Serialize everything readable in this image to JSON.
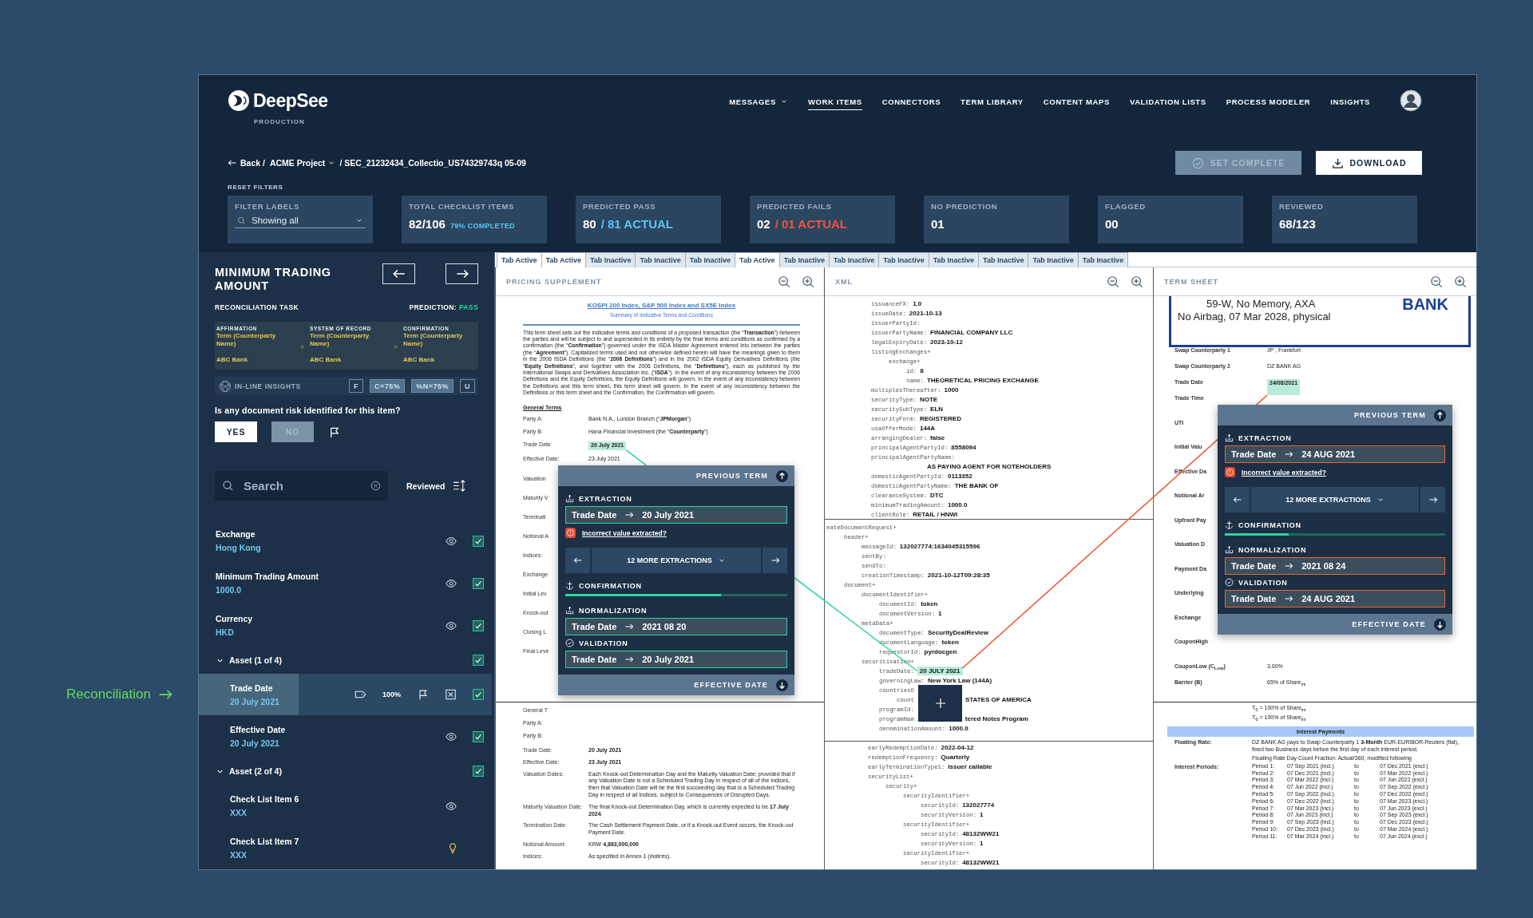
{
  "app": {
    "logo": "DeepSee",
    "environment": "PRODUCTION"
  },
  "nav": [
    {
      "label": "MESSAGES",
      "dropdown": true,
      "selected": false
    },
    {
      "label": "WORK ITEMS",
      "dropdown": false,
      "selected": true
    },
    {
      "label": "CONNECTORS",
      "dropdown": false,
      "selected": false
    },
    {
      "label": "TERM LIBRARY",
      "dropdown": false,
      "selected": false
    },
    {
      "label": "CONTENT MAPS",
      "dropdown": false,
      "selected": false
    },
    {
      "label": "VALIDATION LISTS",
      "dropdown": false,
      "selected": false
    },
    {
      "label": "PROCESS MODELER",
      "dropdown": false,
      "selected": false
    },
    {
      "label": "INSIGHTS",
      "dropdown": false,
      "selected": false
    }
  ],
  "breadcrumb": {
    "back": "Back /",
    "project": "ACME Project",
    "path": "/ SEC_21232434_Collectio_US74329743q 05-09"
  },
  "actions": [
    {
      "label": "SET COMPLETE",
      "kind": "complete",
      "disabled": true
    },
    {
      "label": "DOWNLOAD",
      "kind": "download",
      "disabled": false
    }
  ],
  "reset_filters": "RESET FILTERS",
  "filter": {
    "label": "FILTER LABELS",
    "value": "Showing all"
  },
  "stats": [
    {
      "label": "TOTAL CHECKLIST ITEMS",
      "value": "82/106",
      "extra": "79% COMPLETED",
      "kind": "percent"
    },
    {
      "label": "PREDICTED PASS",
      "value": "80",
      "extra": "/ 81 ACTUAL",
      "kind": "pass"
    },
    {
      "label": "PREDICTED FAILS",
      "value": "02",
      "extra": "/ 01 ACTUAL",
      "kind": "fail"
    },
    {
      "label": "NO PREDICTION",
      "value": "01"
    },
    {
      "label": "FLAGGED",
      "value": "00"
    },
    {
      "label": "REVIEWED",
      "value": "68/123"
    }
  ],
  "side_label": "Reconciliation",
  "task": {
    "title": "MINIMUM TRADING AMOUNT",
    "subtitle": "RECONCILIATION TASK",
    "prediction_label": "PREDICTION:",
    "prediction": "PASS"
  },
  "reconciliation": {
    "columns": [
      {
        "source": "AFFIRMATION",
        "term": "Term (Counterparty Name)",
        "value": "ABC Bank"
      },
      {
        "source": "SYSTEM OF RECORD",
        "term": "Term (Counterparty Name)",
        "value": "ABC Bank"
      },
      {
        "source": "CONFIRMATION",
        "term": "Term (Counterparty Name)",
        "value": "ABC Bank"
      }
    ],
    "separators": [
      "=",
      "="
    ]
  },
  "insights": {
    "label": "IN-LINE INSIGHTS",
    "chips": [
      {
        "label": "F",
        "active": false
      },
      {
        "label": "C=75%",
        "active": true
      },
      {
        "label": "%N=75%",
        "active": true
      },
      {
        "label": "U",
        "active": false
      }
    ]
  },
  "risk": {
    "question": "Is any document risk identified for this item?",
    "options": [
      {
        "label": "YES",
        "selected": true
      },
      {
        "label": "NO",
        "selected": false
      }
    ]
  },
  "search": {
    "placeholder": "Search"
  },
  "sort": {
    "label": "Reviewed"
  },
  "checklist": [
    {
      "kind": "item",
      "label": "Exchange",
      "value": "Hong Kong",
      "reviewed": true,
      "selected": false,
      "hint": false
    },
    {
      "kind": "item",
      "label": "Minimum Trading Amount",
      "value": "1000.0",
      "reviewed": true,
      "selected": false,
      "hint": false
    },
    {
      "kind": "item",
      "label": "Currency",
      "value": "HKD",
      "reviewed": true,
      "selected": false,
      "hint": false
    },
    {
      "kind": "group",
      "label": "Asset (1 of 4)",
      "expanded": true,
      "reviewed": true,
      "children": [
        {
          "kind": "item",
          "label": "Trade Date",
          "value": "20 July 2021",
          "reviewed": true,
          "selected": true,
          "confidence": "100%",
          "hint": false
        },
        {
          "kind": "item",
          "label": "Effective Date",
          "value": "20 July 2021",
          "reviewed": true,
          "selected": false,
          "hint": false
        }
      ]
    },
    {
      "kind": "group",
      "label": "Asset (2 of 4)",
      "expanded": true,
      "reviewed": true,
      "children": [
        {
          "kind": "item",
          "label": "Check List Item 6",
          "value": "XXX",
          "reviewed": false,
          "selected": false,
          "hint": false
        },
        {
          "kind": "item",
          "label": "Check List Item 7",
          "value": "XXX",
          "reviewed": false,
          "selected": false,
          "hint": true
        }
      ]
    }
  ],
  "doc_tabs": [
    {
      "label": "Tab Active",
      "selected": true
    },
    {
      "label": "Tab Active",
      "selected": true
    },
    {
      "label": "Tab Inactive",
      "selected": false
    },
    {
      "label": "Tab Inactive",
      "selected": false
    },
    {
      "label": "Tab Inactive",
      "selected": false
    },
    {
      "label": "Tab Active",
      "selected": true
    },
    {
      "label": "Tab Inactive",
      "selected": false
    },
    {
      "label": "Tab Inactive",
      "selected": false
    },
    {
      "label": "Tab Inactive",
      "selected": false
    },
    {
      "label": "Tab Inactive",
      "selected": false
    },
    {
      "label": "Tab Inactive",
      "selected": false
    },
    {
      "label": "Tab Inactive",
      "selected": false
    },
    {
      "label": "Tab Inactive",
      "selected": false
    }
  ],
  "connectors": [
    {
      "color": "#2ed3a0"
    },
    {
      "color": "#e8572a"
    }
  ],
  "panes": [
    {
      "kind": "pricing",
      "title": "PRICING SUPPLEMENT",
      "heading": "KOSPI 200 Index, S&P 500 Index and SX5E Index",
      "subheading": "Summary of Indicative Terms and Conditions",
      "intro": "This term sheet sets out the indicative terms and conditions of a proposed transaction (the “**Transaction**”) between the parties and will be subject to and superseded in its entirety by the final terms and conditions as confirmed by a confirmation (the “**Confirmation**”) governed under the ISDA Master Agreement entered into between the parties (the “**Agreement**”). Capitalized terms used and not otherwise defined herein will have the meanings given to them in the 2006 ISDA Definitions (the “**2006 Definitions**”) and in the 2002 ISDA Equity Derivatives Definitions (the “**Equity Definitions**”, and together with the 2006 Definitions, the “**Definitions**”), each as published by the International Swaps and Derivatives Association Inc. (“**ISDA**”). In the event of any inconsistency between the 2006 Definitions and the Equity Definitions, the Equity Definitions will govern. In the event of any inconsistency between the Definitions and this term sheet, this term sheet will govern. In the event of any inconsistency between the Definitions or this term sheet and the Confirmation, the Confirmation will govern.",
      "section": "General Terms",
      "rows": [
        {
          "label": "Party A:",
          "value": "Bank N.A., London Branch (“**JPMorgan**”)",
          "highlight": false
        },
        {
          "label": "Party B:",
          "value": "Hana Financial Investment  (the “**Counterparty**”)",
          "highlight": false
        },
        {
          "label": "Trade Date:",
          "value": "20 July 2021",
          "highlight": true
        },
        {
          "label": "Effective Date:",
          "value": "23 July 2021",
          "highlight": false
        }
      ],
      "covered": [
        "Valuation",
        "Maturity V",
        "Terminati",
        "Notional A",
        "Indices:",
        "Exchange",
        "Initial Lev",
        "Knock-out",
        "Closing L",
        "Final Leve"
      ],
      "page2_covered": [
        "General T",
        "Party A:",
        "Party B:"
      ],
      "page2_rows": [
        {
          "label": "Trade Date:",
          "value": "**20 July 2021**"
        },
        {
          "label": "Effective Date:",
          "value": "**23 July 2021**"
        },
        {
          "label": "Valuation Dates:",
          "value": "Each Knock-out Determination Day and the Maturity Valuation Date; provided that if any Valuation Date is not a Scheduled Trading Day in respect of all of the Indices, then that Valuation Date will be the first succeeding day that is a Scheduled Trading Day in respect of all Indices, subject to Consequences of Disrupted Days."
        },
        {
          "label": "Maturity Valuation Date:",
          "value": "The final Knock-out Determination Day, which is currently expected to be **17 July 2024**."
        },
        {
          "label": "Termination Date:",
          "value": "The Cash Settlement Payment Date, or if a Knock-out Event occurs, the Knock-out Payment Date."
        },
        {
          "label": "Notional Amount:",
          "value": "KRW  **4,863,000,000**"
        },
        {
          "label": "Indices:",
          "value": "As specified in Annex 1 (*Indices*)."
        }
      ],
      "popup": {
        "kind": "match",
        "previous": "PREVIOUS TERM",
        "next": "EFFECTIVE DATE",
        "extraction": {
          "label": "EXTRACTION",
          "term": "Trade Date",
          "value": "20 July 2021"
        },
        "error": "Incorrect value extracted?",
        "more": "12 MORE EXTRACTIONS",
        "confirmation": {
          "label": "CONFIRMATION",
          "level": 0.7
        },
        "normalization": {
          "label": "NORMALIZATION",
          "term": "Trade Date",
          "value": "2021 08 20"
        },
        "validation": {
          "label": "VALIDATION",
          "term": "Trade Date",
          "value": "20 July 2021"
        }
      }
    },
    {
      "kind": "xml",
      "title": "XML",
      "sections": [
        [
          {
            "key": "issuanceFX:",
            "value": "1.0"
          },
          {
            "key": "issueDate:",
            "value": "2021-10-13"
          },
          {
            "key": "issuerPartyId:"
          },
          {
            "key": "issuerPartyName:",
            "value": "FINANCIAL COMPANY LLC"
          },
          {
            "key": "legalExpiryDate:",
            "value": "2023-10-12"
          },
          {
            "key": "listingExchanges+",
            "children": [
              {
                "key": "exchange+",
                "children": [
                  {
                    "key": "id:",
                    "value": "8"
                  },
                  {
                    "key": "name:",
                    "value": "THEORETICAL PRICING EXCHANGE"
                  }
                ]
              }
            ]
          },
          {
            "key": "multiplesThereafter:",
            "value": "1000"
          },
          {
            "key": "securityType:",
            "value": "NOTE"
          },
          {
            "key": "securitySubType:",
            "value": "ELN"
          },
          {
            "key": "securityForm:",
            "value": "REGISTERED"
          },
          {
            "key": "usaOfferMode:",
            "value": "144A"
          },
          {
            "key": "arrangingDealer:",
            "value": "false"
          },
          {
            "key": "principalAgentPartyId:",
            "value": "8558094"
          },
          {
            "key": "principalAgentPartyName:",
            "children": [
              {
                "children": [
                  {
                    "children": [
                      {
                        "value": "AS PAYING AGENT FOR NOTEHOLDERS"
                      }
                    ]
                  }
                ]
              }
            ]
          },
          {
            "key": "domesticAgentPartyId:",
            "value": "0113352"
          },
          {
            "key": "domesticAgentPartyName:",
            "value": "THE BANK OF"
          },
          {
            "key": "clearanceSystem:",
            "value": "DTC"
          },
          {
            "key": "minimumTradingAmount:",
            "value": "1000.0"
          },
          {
            "key": "clientRole:",
            "value": "RETAIL / HNWI"
          }
        ],
        [
          {
            "key": "eateDocumentRequest+",
            "children": [
              {
                "key": "header+",
                "children": [
                  {
                    "key": "messageId:",
                    "value": "132027774:1634045315596"
                  },
                  {
                    "key": "sentBy:"
                  },
                  {
                    "key": "sendTo:"
                  },
                  {
                    "key": "creationTimestamp:",
                    "value": "2021-10-12T09:28:35"
                  }
                ]
              },
              {
                "key": "document+",
                "children": [
                  {
                    "key": "documentIdentifier+",
                    "children": [
                      {
                        "key": "documentId:",
                        "value": "token"
                      },
                      {
                        "key": "documentVersion:",
                        "value": "1"
                      }
                    ]
                  },
                  {
                    "key": "metaData+",
                    "children": [
                      {
                        "key": "documentType:",
                        "value": "SecurityDealReview"
                      },
                      {
                        "key": "documentLanguage:",
                        "value": "token"
                      },
                      {
                        "key": "requestorId:",
                        "value": "pyrdocgen"
                      }
                    ]
                  },
                  {
                    "key": "securitisation+",
                    "children": [
                      {
                        "key": "tradeDate:",
                        "value": "20 JULY 2021",
                        "highlight": true
                      },
                      {
                        "key": "governingLaw:",
                        "value": "New York Law (144A)"
                      },
                      {
                        "key": "countriesO",
                        "children": [
                          {
                            "key": "count",
                            "value": "STATES OF AMERICA",
                            "gap": true
                          }
                        ]
                      },
                      {
                        "key": "programId:"
                      },
                      {
                        "key": "programNam",
                        "value": "tered Notes Program",
                        "gap": true
                      },
                      {
                        "key": "denominationAmount:",
                        "value": "1000.0"
                      }
                    ]
                  }
                ]
              }
            ]
          }
        ],
        [
          {
            "key": "earlyRedemptionDate:",
            "value": "2022-04-12"
          },
          {
            "key": "redemptionFrequency:",
            "value": "Quarterly"
          },
          {
            "key": "earlyTerminationType1:",
            "value": "Issuer callable"
          },
          {
            "key": "securityList+",
            "children": [
              {
                "key": "security+",
                "children": [
                  {
                    "key": "securityIdentifier+",
                    "children": [
                      {
                        "key": "securityId:",
                        "value": "132027774"
                      },
                      {
                        "key": "securityVersion:",
                        "value": "1"
                      }
                    ]
                  },
                  {
                    "key": "securityIdentifier+",
                    "children": [
                      {
                        "key": "securityId:",
                        "value": "48132WW21"
                      },
                      {
                        "key": "securityVersion:",
                        "value": "1"
                      }
                    ]
                  },
                  {
                    "key": "securityIdentifier+",
                    "children": [
                      {
                        "key": "securityId:",
                        "value": "48132WW21"
                      }
                    ]
                  }
                ]
              }
            ]
          }
        ]
      ]
    },
    {
      "kind": "termsheet",
      "title": "TERM SHEET",
      "banner": {
        "line1": "59-W, No Memory, AXA",
        "line2": "No Airbag, 07 Mar 2028, physical",
        "brand": "BANK"
      },
      "rows": [
        {
          "label": "Swap Counterparty 1",
          "value": "JP                    , Frankfurt",
          "highlight": false
        },
        {
          "label": "Swap Counterparty 2",
          "value": "DZ BANK AG",
          "highlight": false
        },
        {
          "label": "Trade Date",
          "value": "24/08/2021",
          "highlight": true
        }
      ],
      "covered": [
        "Trade Time",
        "UTI",
        "Initial Valu",
        "Effective Da",
        "Notional Ar",
        "Upfront Pay",
        "Valuation D",
        "Payment Da",
        "Underlying",
        "Exchange",
        "CouponHigh"
      ],
      "rows_after": [
        {
          "label": "CouponLow (C$_{Low}$)",
          "value": "3.00%"
        },
        {
          "label": "Barrier (B)",
          "value": "65% of Share$_{ini}$"
        }
      ],
      "page2_lines": [
        "T$_{5}$ = 100%      of Share$_{ini}$",
        "T$_{6}$ = 100%      of Share$_{ini}$"
      ],
      "band": "Interest Payments",
      "floating": {
        "label": "Floating Rate:",
        "text": "DZ BANK AG pays to Swap Counterparty 1 **3-Month** EUR-EURIBOR-Reuters (flat), fixed two Business days before the first day of each interest period.",
        "daycount": "Floating Rate Day Count Fraction:   Actual/360; modified following"
      },
      "periods_label": "Interest Periods:",
      "periods": [
        [
          "Period 1:",
          "07 Sep 2021  (incl.)",
          "to",
          "07 Dec 2021  (excl.)"
        ],
        [
          "Period 2:",
          "07 Dec 2021  (incl.)",
          "to",
          "07 Mar 2022  (excl.)"
        ],
        [
          "Period 3:",
          "07 Mar 2022  (incl.)",
          "to",
          "07 Jun 2022  (excl.)"
        ],
        [
          "Period 4:",
          "07 Jun 2022  (incl.)",
          "to",
          "07 Sep 2022  (excl.)"
        ],
        [
          "Period 5:",
          "07 Sep 2022  (incl.)",
          "to",
          "07 Dec 2022  (excl.)"
        ],
        [
          "Period 6:",
          "07 Dec 2022  (incl.)",
          "to",
          "07 Mar 2023  (excl.)"
        ],
        [
          "Period 7:",
          "07 Mar 2023  (incl.)",
          "to",
          "07 Jun 2023  (excl.)"
        ],
        [
          "Period 8:",
          "07 Jun 2023  (incl.)",
          "to",
          "07 Sep 2023  (excl.)"
        ],
        [
          "Period 9:",
          "07 Sep 2023  (incl.)",
          "to",
          "07 Dec 2023  (excl.)"
        ],
        [
          "Period 10:",
          "07 Dec 2023  (incl.)",
          "to",
          "07 Mar 2024  (excl.)"
        ],
        [
          "Period 11:",
          "07 Mar 2024  (incl.)",
          "to",
          "07 Jun 2024  (excl.)"
        ]
      ],
      "popup": {
        "kind": "mismatch",
        "previous": "PREVIOUS TERM",
        "next": "EFFECTIVE DATE",
        "extraction": {
          "label": "EXTRACTION",
          "term": "Trade Date",
          "value": "24 AUG 2021"
        },
        "error": "Incorrect value extracted?",
        "more": "12 MORE EXTRACTIONS",
        "confirmation": {
          "label": "CONFIRMATION",
          "level": 0.29
        },
        "normalization": {
          "label": "NORMALIZATION",
          "term": "Trade Date",
          "value": "2021 08 24"
        },
        "validation": {
          "label": "VALIDATION",
          "term": "Trade Date",
          "value": "24 AUG 2021"
        }
      }
    }
  ]
}
